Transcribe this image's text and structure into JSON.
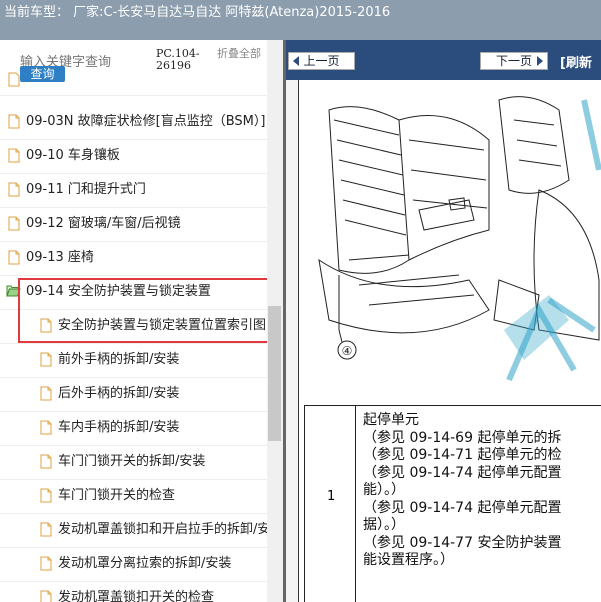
{
  "header": {
    "title": "当前车型：  厂家:C-长安马自达马自达 阿特兹(Atenza)2015-2016"
  },
  "search": {
    "placeholder": "输入关键字查询",
    "button_label": "查询",
    "code": "PC.104-26196",
    "collapse_label": "折叠全部"
  },
  "tree": {
    "items": [
      {
        "label": "09-03N 故障症状检修[盲点监控（BSM）]"
      },
      {
        "label": "09-10 车身镶板"
      },
      {
        "label": "09-11 门和提升式门"
      },
      {
        "label": "09-12 窗玻璃/车窗/后视镜"
      },
      {
        "label": "09-13 座椅"
      },
      {
        "label": "09-14 安全防护装置与锁定装置"
      },
      {
        "label": "安全防护装置与锁定装置位置索引图"
      },
      {
        "label": "前外手柄的拆卸/安装"
      },
      {
        "label": "后外手柄的拆卸/安装"
      },
      {
        "label": "车内手柄的拆卸/安装"
      },
      {
        "label": "车门门锁开关的拆卸/安装"
      },
      {
        "label": "车门门锁开关的检查"
      },
      {
        "label": "发动机罩盖锁扣和开启拉手的拆卸/安"
      },
      {
        "label": "发动机罩分离拉索的拆卸/安装"
      },
      {
        "label": "发动机罩盖锁扣开关的检查"
      }
    ]
  },
  "viewer": {
    "prev_label": "上一页",
    "next_label": "下一页",
    "refresh_label": "[刷新",
    "callout": "④",
    "row_number": "1",
    "row_lines": [
      "起停单元",
      "（参见 09-14-69 起停单元的拆",
      "（参见 09-14-71 起停单元的检",
      "（参见 09-14-74 起停单元配置",
      "能）。）",
      "（参见 09-14-74 起停单元配置",
      "据）。）",
      "（参见 09-14-77 安全防护装置",
      "能设置程序。）"
    ]
  },
  "colors": {
    "topbar": "#8c9dad",
    "nav": "#2a4d7e",
    "highlight": "#e0393e",
    "button": "#2f7fc4"
  }
}
